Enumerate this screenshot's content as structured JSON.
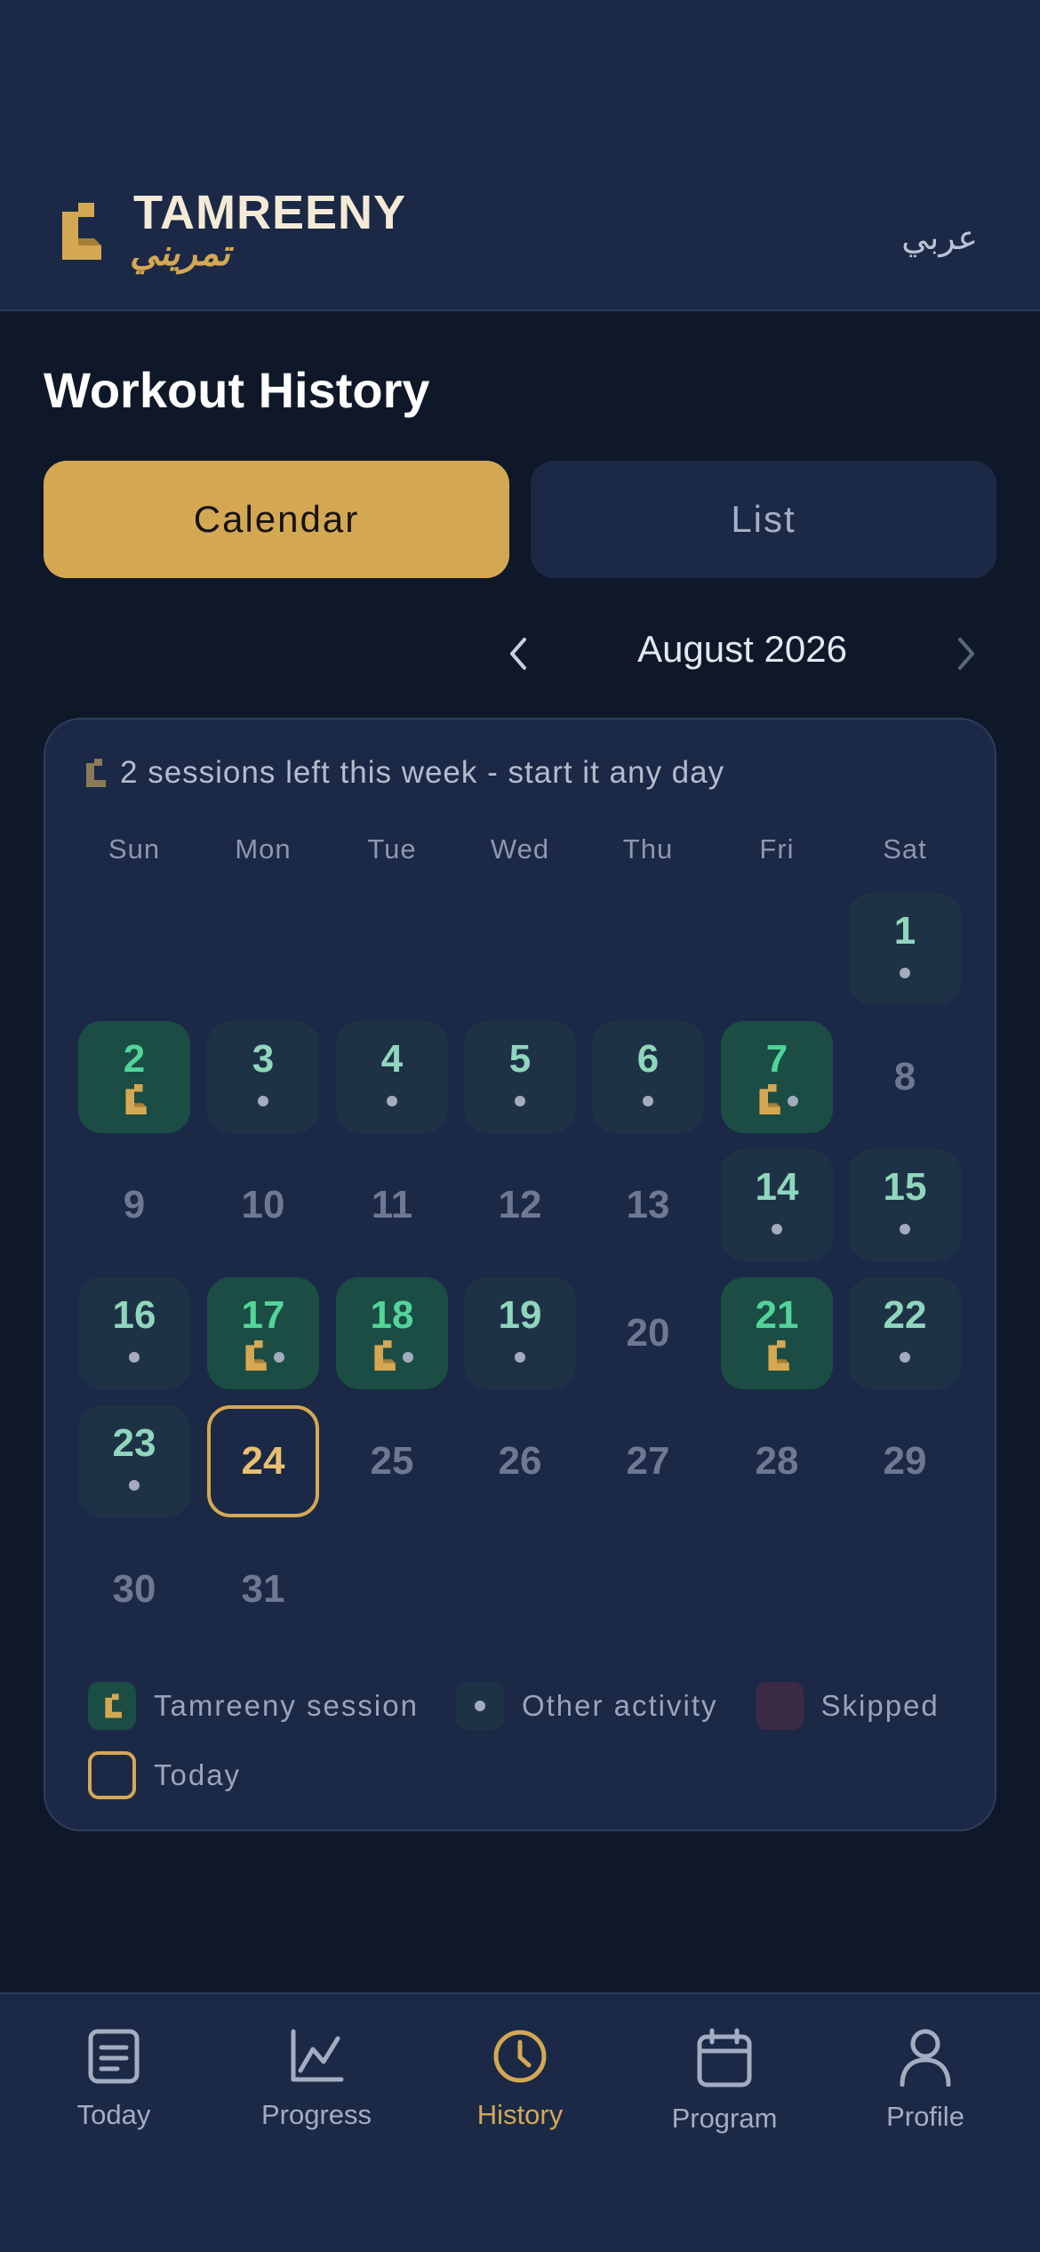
{
  "header": {
    "brand_en": "TAMREENY",
    "brand_ar": "تمريني",
    "language_toggle": "عربي"
  },
  "page": {
    "title": "Workout History"
  },
  "view_toggle": {
    "calendar": "Calendar",
    "list": "List",
    "selected": "Calendar"
  },
  "calendar": {
    "month_label": "August 2026",
    "sessions_note": "2 sessions left this week - start it any day",
    "weekdays": [
      "Sun",
      "Mon",
      "Tue",
      "Wed",
      "Thu",
      "Fri",
      "Sat"
    ],
    "days": [
      {
        "n": "1",
        "type": "other"
      },
      {
        "n": "2",
        "type": "tam",
        "dot": false
      },
      {
        "n": "3",
        "type": "other"
      },
      {
        "n": "4",
        "type": "other"
      },
      {
        "n": "5",
        "type": "other"
      },
      {
        "n": "6",
        "type": "other"
      },
      {
        "n": "7",
        "type": "tam",
        "dot": true
      },
      {
        "n": "8",
        "type": "plain"
      },
      {
        "n": "9",
        "type": "plain"
      },
      {
        "n": "10",
        "type": "plain"
      },
      {
        "n": "11",
        "type": "plain"
      },
      {
        "n": "12",
        "type": "plain"
      },
      {
        "n": "13",
        "type": "plain"
      },
      {
        "n": "14",
        "type": "other"
      },
      {
        "n": "15",
        "type": "other"
      },
      {
        "n": "16",
        "type": "other"
      },
      {
        "n": "17",
        "type": "tam",
        "dot": true
      },
      {
        "n": "18",
        "type": "tam",
        "dot": true
      },
      {
        "n": "19",
        "type": "other"
      },
      {
        "n": "20",
        "type": "plain"
      },
      {
        "n": "21",
        "type": "tam",
        "dot": false
      },
      {
        "n": "22",
        "type": "other"
      },
      {
        "n": "23",
        "type": "other"
      },
      {
        "n": "24",
        "type": "today"
      },
      {
        "n": "25",
        "type": "plain"
      },
      {
        "n": "26",
        "type": "plain"
      },
      {
        "n": "27",
        "type": "plain"
      },
      {
        "n": "28",
        "type": "plain"
      },
      {
        "n": "29",
        "type": "plain"
      },
      {
        "n": "30",
        "type": "plain"
      },
      {
        "n": "31",
        "type": "plain"
      }
    ],
    "first_weekday_index": 6
  },
  "legend": {
    "tamreeny": "Tamreeny session",
    "other": "Other activity",
    "skipped": "Skipped",
    "today": "Today"
  },
  "nav": {
    "items": [
      {
        "label": "Today",
        "icon": "document-icon"
      },
      {
        "label": "Progress",
        "icon": "chart-icon"
      },
      {
        "label": "History",
        "icon": "clock-icon"
      },
      {
        "label": "Program",
        "icon": "calendar-icon"
      },
      {
        "label": "Profile",
        "icon": "user-icon"
      }
    ],
    "active": "History"
  },
  "colors": {
    "accent": "#d4a853",
    "session_bg": "#1b4d45",
    "session_text": "#52d49a",
    "other_bg": "#1e3246",
    "skipped_bg": "#3a2a45"
  }
}
